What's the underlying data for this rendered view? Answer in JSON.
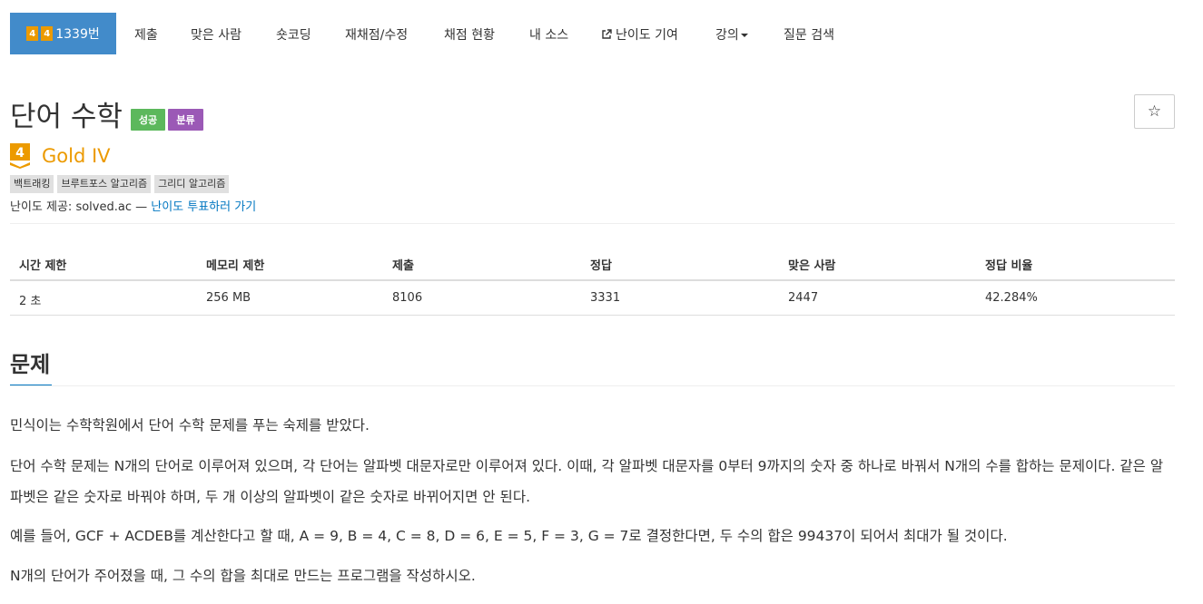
{
  "nav": {
    "active": {
      "tier_digits": [
        "4",
        "4"
      ],
      "label": "1339번"
    },
    "items": [
      "제출",
      "맞은 사람",
      "숏코딩",
      "재채점/수정",
      "채점 현황",
      "내 소스",
      "난이도 기여",
      "강의",
      "질문 검색"
    ]
  },
  "problem": {
    "title": "단어 수학",
    "label_success": "성공",
    "label_tag": "분류",
    "star": "☆",
    "tier_digit": "4",
    "tier": "Gold IV",
    "algorithm_tags": [
      "백트래킹",
      "브루트포스 알고리즘",
      "그리디 알고리즘"
    ],
    "provider_prefix": "난이도 제공: solved.ac — ",
    "provider_link": "난이도 투표하러 가기"
  },
  "stats": {
    "headers": [
      "시간 제한",
      "메모리 제한",
      "제출",
      "정답",
      "맞은 사람",
      "정답 비율"
    ],
    "values": [
      "2 초",
      "256 MB",
      "8106",
      "3331",
      "2447",
      "42.284%"
    ]
  },
  "section": {
    "title": "문제",
    "paragraphs": [
      "민식이는 수학학원에서 단어 수학 문제를 푸는 숙제를 받았다.",
      "단어 수학 문제는 N개의 단어로 이루어져 있으며, 각 단어는 알파벳 대문자로만 이루어져 있다. 이때, 각 알파벳 대문자를 0부터 9까지의 숫자 중 하나로 바꿔서 N개의 수를 합하는 문제이다. 같은 알파벳은 같은 숫자로 바꿔야 하며, 두 개 이상의 알파벳이 같은 숫자로 바뀌어지면 안 된다.",
      "예를 들어, GCF + ACDEB를 계산한다고 할 때, A = 9, B = 4, C = 8, D = 6, E = 5, F = 3, G = 7로 결정한다면, 두 수의 합은 99437이 되어서 최대가 될 것이다.",
      "N개의 단어가 주어졌을 때, 그 수의 합을 최대로 만드는 프로그램을 작성하시오."
    ]
  },
  "colors": {
    "nav_active": "#428bca",
    "gold": "#ec9a00",
    "success": "#5cb85c",
    "tag": "#9b59b6",
    "link": "#0076c0"
  }
}
